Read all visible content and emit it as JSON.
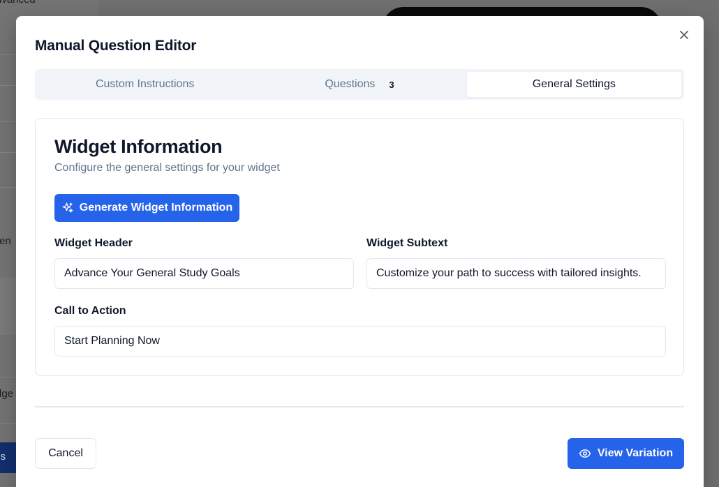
{
  "background": {
    "texts": [
      "dvanced",
      "ren",
      ".",
      "dge",
      "ons"
    ]
  },
  "modal": {
    "title": "Manual Question Editor",
    "close_icon": "close-icon"
  },
  "tabs": [
    {
      "label": "Custom Instructions",
      "active": false
    },
    {
      "label": "Questions",
      "badge": "3",
      "active": false
    },
    {
      "label": "General Settings",
      "active": true
    }
  ],
  "card": {
    "title": "Widget Information",
    "subtitle": "Configure the general settings for your widget",
    "generate_button": {
      "label": "Generate Widget Information",
      "icon": "sparkles-icon"
    }
  },
  "fields": {
    "widget_header": {
      "label": "Widget Header",
      "value": "Advance Your General Study Goals"
    },
    "widget_subtext": {
      "label": "Widget Subtext",
      "value": "Customize your path to success with tailored insights."
    },
    "call_to_action": {
      "label": "Call to Action",
      "value": "Start Planning Now"
    }
  },
  "footer": {
    "cancel_label": "Cancel",
    "view_label": "View Variation",
    "view_icon": "eye-icon"
  },
  "colors": {
    "primary": "#2563eb",
    "text": "#0f172a",
    "muted": "#64748b",
    "border": "#e2e8f0",
    "tab_bg": "#f1f5f9"
  }
}
